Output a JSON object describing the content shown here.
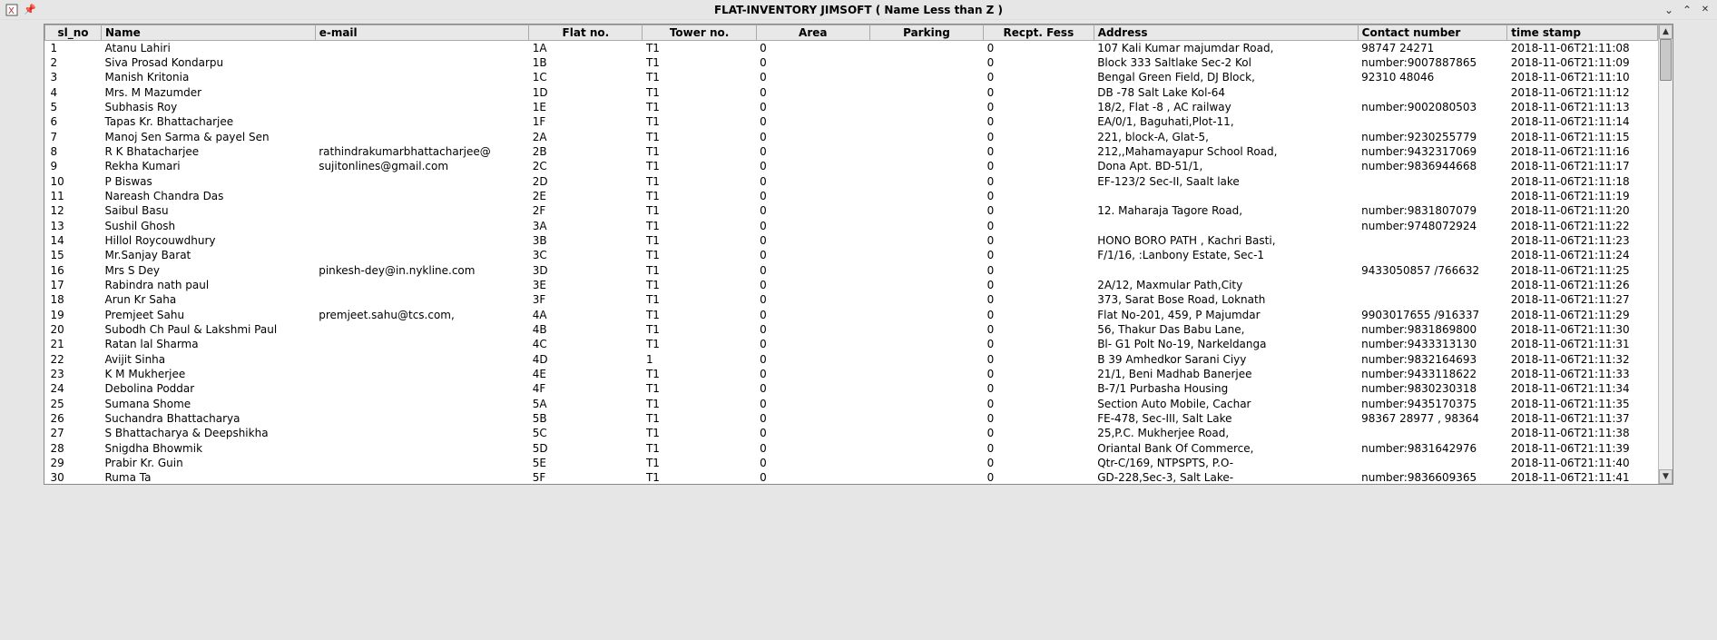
{
  "window": {
    "title": "FLAT-INVENTORY JIMSOFT ( Name Less than Z )"
  },
  "columns": {
    "sl_no": "sl_no",
    "name": "Name",
    "email": "e-mail",
    "flat": "Flat no.",
    "tower": "Tower no.",
    "area": "Area",
    "parking": "Parking",
    "fees": "Recpt. Fess",
    "address": "Address",
    "contact": "Contact number",
    "timestamp": "time stamp"
  },
  "rows": [
    {
      "sl": "1",
      "name": "Atanu Lahiri",
      "email": "",
      "flat": "1A",
      "tower": "T1",
      "area": "0",
      "park": "",
      "fees": "0",
      "addr": "107 Kali Kumar majumdar Road,",
      "contact": "98747 24271",
      "ts": "2018-11-06T21:11:08"
    },
    {
      "sl": "2",
      "name": "Siva Prosad Kondarpu",
      "email": "",
      "flat": "1B",
      "tower": "T1",
      "area": "0",
      "park": "",
      "fees": "0",
      "addr": "Block 333 Saltlake Sec-2 Kol",
      "contact": "number:9007887865",
      "ts": "2018-11-06T21:11:09"
    },
    {
      "sl": "3",
      "name": "Manish Kritonia",
      "email": "",
      "flat": "1C",
      "tower": "T1",
      "area": "0",
      "park": "",
      "fees": "0",
      "addr": "Bengal Green Field, DJ Block,",
      "contact": "92310 48046",
      "ts": "2018-11-06T21:11:10"
    },
    {
      "sl": "4",
      "name": "Mrs. M Mazumder",
      "email": "",
      "flat": "1D",
      "tower": "T1",
      "area": "0",
      "park": "",
      "fees": "0",
      "addr": "DB -78 Salt Lake Kol-64",
      "contact": "",
      "ts": "2018-11-06T21:11:12"
    },
    {
      "sl": "5",
      "name": "Subhasis Roy",
      "email": "",
      "flat": "1E",
      "tower": "T1",
      "area": "0",
      "park": "",
      "fees": "0",
      "addr": "18/2, Flat -8 , AC railway",
      "contact": "number:9002080503",
      "ts": "2018-11-06T21:11:13"
    },
    {
      "sl": "6",
      "name": "Tapas Kr. Bhattacharjee",
      "email": "",
      "flat": "1F",
      "tower": "T1",
      "area": "0",
      "park": "",
      "fees": "0",
      "addr": "EA/0/1, Baguhati,Plot-11,",
      "contact": "",
      "ts": "2018-11-06T21:11:14"
    },
    {
      "sl": "7",
      "name": "Manoj  Sen Sarma & payel Sen",
      "email": "",
      "flat": "2A",
      "tower": "T1",
      "area": "0",
      "park": "",
      "fees": "0",
      "addr": "221, block-A, Glat-5,",
      "contact": "number:9230255779",
      "ts": "2018-11-06T21:11:15"
    },
    {
      "sl": "8",
      "name": "R K Bhatacharjee",
      "email": "rathindrakumarbhattacharjee@",
      "flat": "2B",
      "tower": "T1",
      "area": "0",
      "park": "",
      "fees": "0",
      "addr": "212,,Mahamayapur School Road,",
      "contact": "number:9432317069",
      "ts": "2018-11-06T21:11:16"
    },
    {
      "sl": "9",
      "name": "Rekha Kumari",
      "email": "sujitonlines@gmail.com",
      "flat": "2C",
      "tower": "T1",
      "area": "0",
      "park": "",
      "fees": "0",
      "addr": "Dona Apt. BD-51/1,",
      "contact": "number:9836944668",
      "ts": "2018-11-06T21:11:17"
    },
    {
      "sl": "10",
      "name": "P Biswas",
      "email": "",
      "flat": "2D",
      "tower": "T1",
      "area": "0",
      "park": "",
      "fees": "0",
      "addr": "EF-123/2 Sec-II, Saalt lake",
      "contact": "",
      "ts": "2018-11-06T21:11:18"
    },
    {
      "sl": "11",
      "name": "Nareash Chandra Das",
      "email": "",
      "flat": "2E",
      "tower": "T1",
      "area": "0",
      "park": "",
      "fees": "0",
      "addr": "",
      "contact": "",
      "ts": "2018-11-06T21:11:19"
    },
    {
      "sl": "12",
      "name": "Saibul Basu",
      "email": "",
      "flat": "2F",
      "tower": "T1",
      "area": "0",
      "park": "",
      "fees": "0",
      "addr": "12. Maharaja Tagore Road,",
      "contact": "number:9831807079",
      "ts": "2018-11-06T21:11:20"
    },
    {
      "sl": "13",
      "name": "Sushil Ghosh",
      "email": "",
      "flat": "3A",
      "tower": "T1",
      "area": "0",
      "park": "",
      "fees": "0",
      "addr": "",
      "contact": "number:9748072924",
      "ts": "2018-11-06T21:11:22"
    },
    {
      "sl": "14",
      "name": "Hillol Roycouwdhury",
      "email": "",
      "flat": "3B",
      "tower": "T1",
      "area": "0",
      "park": "",
      "fees": "0",
      "addr": "HONO BORO PATH , Kachri Basti,",
      "contact": "",
      "ts": "2018-11-06T21:11:23"
    },
    {
      "sl": "15",
      "name": "Mr.Sanjay Barat",
      "email": "",
      "flat": "3C",
      "tower": "T1",
      "area": "0",
      "park": "",
      "fees": "0",
      "addr": "F/1/16, :Lanbony Estate, Sec-1",
      "contact": "",
      "ts": "2018-11-06T21:11:24"
    },
    {
      "sl": "16",
      "name": "Mrs S Dey",
      "email": "pinkesh-dey@in.nykline.com",
      "flat": "3D",
      "tower": "T1",
      "area": "0",
      "park": "",
      "fees": "0",
      "addr": "",
      "contact": "9433050857 /766632",
      "ts": "2018-11-06T21:11:25"
    },
    {
      "sl": "17",
      "name": "Rabindra nath paul",
      "email": "",
      "flat": "3E",
      "tower": "T1",
      "area": "0",
      "park": "",
      "fees": "0",
      "addr": "2A/12, Maxmular Path,City",
      "contact": "",
      "ts": "2018-11-06T21:11:26"
    },
    {
      "sl": "18",
      "name": "Arun Kr Saha",
      "email": "",
      "flat": "3F",
      "tower": "T1",
      "area": "0",
      "park": "",
      "fees": "0",
      "addr": "373, Sarat Bose Road, Loknath",
      "contact": "",
      "ts": "2018-11-06T21:11:27"
    },
    {
      "sl": "19",
      "name": "Premjeet Sahu",
      "email": "premjeet.sahu@tcs.com,",
      "flat": "4A",
      "tower": "T1",
      "area": "0",
      "park": "",
      "fees": "0",
      "addr": "Flat No-201, 459, P Majumdar",
      "contact": "9903017655 /916337",
      "ts": "2018-11-06T21:11:29"
    },
    {
      "sl": "20",
      "name": "Subodh Ch Paul & Lakshmi Paul",
      "email": "",
      "flat": "4B",
      "tower": "T1",
      "area": "0",
      "park": "",
      "fees": "0",
      "addr": "56, Thakur Das Babu Lane,",
      "contact": "number:9831869800",
      "ts": "2018-11-06T21:11:30"
    },
    {
      "sl": "21",
      "name": "Ratan lal Sharma",
      "email": "",
      "flat": "4C",
      "tower": "T1",
      "area": "0",
      "park": "",
      "fees": "0",
      "addr": "Bl- G1 Polt No-19, Narkeldanga",
      "contact": "number:9433313130",
      "ts": "2018-11-06T21:11:31"
    },
    {
      "sl": "22",
      "name": "Avijit Sinha",
      "email": "",
      "flat": "4D",
      "tower": "1",
      "area": "0",
      "park": "",
      "fees": "0",
      "addr": "B 39 Amhedkor Sarani Ciyy",
      "contact": "number:9832164693",
      "ts": "2018-11-06T21:11:32"
    },
    {
      "sl": "23",
      "name": "K M Mukherjee",
      "email": "",
      "flat": "4E",
      "tower": "T1",
      "area": "0",
      "park": "",
      "fees": "0",
      "addr": "21/1, Beni Madhab Banerjee",
      "contact": "number:9433118622",
      "ts": "2018-11-06T21:11:33"
    },
    {
      "sl": "24",
      "name": "Debolina Poddar",
      "email": "",
      "flat": "4F",
      "tower": "T1",
      "area": "0",
      "park": "",
      "fees": "0",
      "addr": "B-7/1 Purbasha Housing",
      "contact": "number:9830230318",
      "ts": "2018-11-06T21:11:34"
    },
    {
      "sl": "25",
      "name": "Sumana Shome",
      "email": "",
      "flat": "5A",
      "tower": "T1",
      "area": "0",
      "park": "",
      "fees": "0",
      "addr": "Section Auto Mobile, Cachar",
      "contact": "number:9435170375",
      "ts": "2018-11-06T21:11:35"
    },
    {
      "sl": "26",
      "name": "Suchandra Bhattacharya",
      "email": "",
      "flat": "5B",
      "tower": "T1",
      "area": "0",
      "park": "",
      "fees": "0",
      "addr": "FE-478, Sec-III, Salt Lake",
      "contact": "98367 28977 , 98364",
      "ts": "2018-11-06T21:11:37"
    },
    {
      "sl": "27",
      "name": "S Bhattacharya & Deepshikha",
      "email": "",
      "flat": "5C",
      "tower": "T1",
      "area": "0",
      "park": "",
      "fees": "0",
      "addr": "25,P.C. Mukherjee Road,",
      "contact": "",
      "ts": "2018-11-06T21:11:38"
    },
    {
      "sl": "28",
      "name": "Snigdha Bhowmik",
      "email": "",
      "flat": "5D",
      "tower": "T1",
      "area": "0",
      "park": "",
      "fees": "0",
      "addr": "Oriantal Bank Of Commerce,",
      "contact": "number:9831642976",
      "ts": "2018-11-06T21:11:39"
    },
    {
      "sl": "29",
      "name": "Prabir Kr. Guin",
      "email": "",
      "flat": "5E",
      "tower": "T1",
      "area": "0",
      "park": "",
      "fees": "0",
      "addr": "Qtr-C/169, NTPSPTS, P.O-",
      "contact": "",
      "ts": "2018-11-06T21:11:40"
    },
    {
      "sl": "30",
      "name": "Ruma Ta",
      "email": "",
      "flat": "5F",
      "tower": "T1",
      "area": "0",
      "park": "",
      "fees": "0",
      "addr": "GD-228,Sec-3, Salt Lake-",
      "contact": "number:9836609365",
      "ts": "2018-11-06T21:11:41"
    }
  ]
}
